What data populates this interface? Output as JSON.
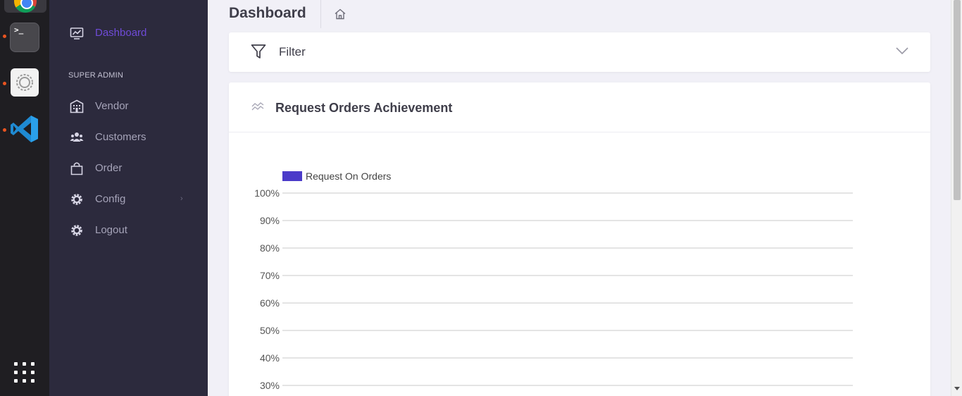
{
  "dock": {
    "apps": [
      "chrome",
      "terminal",
      "settings",
      "vscode"
    ],
    "terminal_prompt": ">_"
  },
  "sidebar": {
    "active_item": {
      "label": "Dashboard",
      "icon": "monitor-chart-icon"
    },
    "section_title": "SUPER ADMIN",
    "items": [
      {
        "label": "Vendor",
        "icon": "building-icon"
      },
      {
        "label": "Customers",
        "icon": "users-icon"
      },
      {
        "label": "Order",
        "icon": "shopping-bag-icon"
      },
      {
        "label": "Config",
        "icon": "gear-icon",
        "has_submenu": true,
        "submenu_glyph": "›"
      },
      {
        "label": "Logout",
        "icon": "gear-icon"
      }
    ]
  },
  "header": {
    "title": "Dashboard"
  },
  "filter": {
    "label": "Filter"
  },
  "chart_card": {
    "title": "Request Orders Achievement"
  },
  "colors": {
    "accent": "#6f4bd8",
    "series": "#4b3bc9",
    "sidebar_bg": "#2c2a3d",
    "page_bg": "#f1f0f7"
  },
  "chart_data": {
    "type": "bar",
    "title": "",
    "xlabel": "",
    "ylabel": "",
    "ylim": [
      0,
      100
    ],
    "y_ticks": [
      "100%",
      "90%",
      "80%",
      "70%",
      "60%",
      "50%",
      "40%",
      "30%"
    ],
    "y_tick_values": [
      100,
      90,
      80,
      70,
      60,
      50,
      40,
      30
    ],
    "legend": "top-left",
    "grid": true,
    "categories": [],
    "series": [
      {
        "name": "Request On Orders",
        "values": [],
        "color": "#4b3bc9"
      }
    ]
  }
}
